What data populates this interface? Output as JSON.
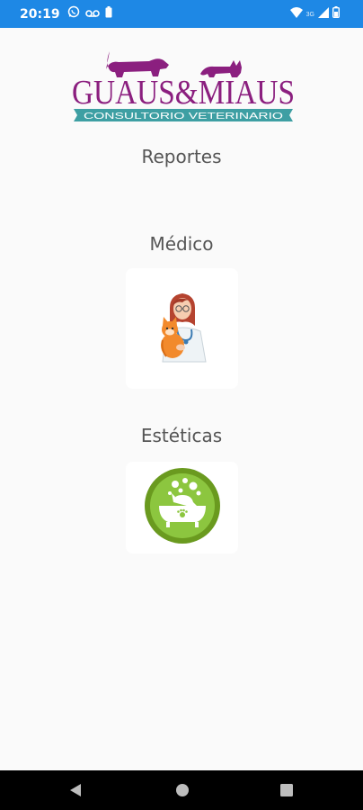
{
  "status_bar": {
    "time": "20:19",
    "network_label": "3G",
    "icons_left": [
      "whatsapp-icon",
      "voicemail-icon",
      "battery-saver-icon"
    ],
    "icons_right": [
      "wifi-icon",
      "signal-icon",
      "battery-icon"
    ]
  },
  "logo": {
    "brand_text": "GUAUS&MIAUS",
    "tagline": "CONSULTORIO VETERINARIO",
    "colors": {
      "purple": "#8b1f7f",
      "teal": "#3e9fa3"
    }
  },
  "main": {
    "heading": "Reportes",
    "sections": [
      {
        "label": "Médico",
        "icon": "veterinarian-with-cat-icon"
      },
      {
        "label": "Estéticas",
        "icon": "pet-bath-icon"
      }
    ]
  },
  "nav_bar": {
    "buttons": [
      "back-icon",
      "home-icon",
      "recents-icon"
    ]
  }
}
